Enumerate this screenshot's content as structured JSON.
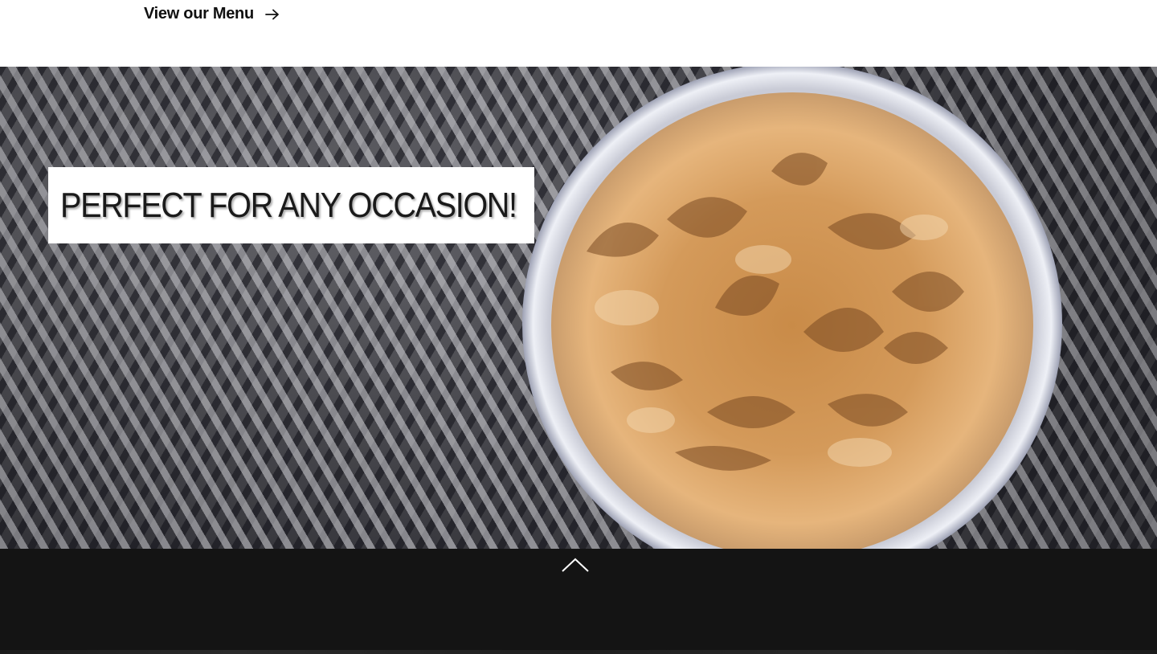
{
  "menu_link": {
    "label": "View our Menu",
    "icon": "arrow-right-icon"
  },
  "hero": {
    "headline": "PERFECT FOR ANY OCCASION!",
    "image": "iced-coffee-cup-image"
  },
  "footer": {
    "back_to_top_icon": "chevron-up-icon",
    "background": "#141414"
  }
}
